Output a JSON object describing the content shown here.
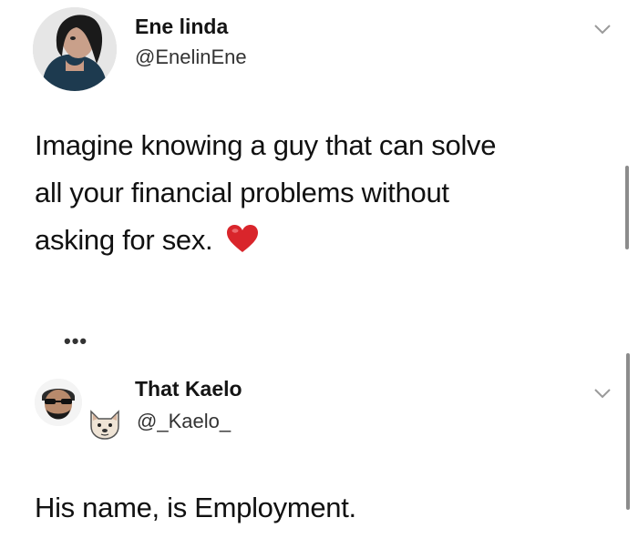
{
  "tweets": [
    {
      "display_name": "Ene linda",
      "handle": "@EnelinEne",
      "text_lines": [
        "Imagine knowing a guy that can solve",
        "all your financial problems without",
        "asking for sex."
      ],
      "emoji": "heart-emoji"
    },
    {
      "display_name": "That Kaelo",
      "handle": "@_Kaelo_",
      "text_lines": [
        "His name, is Employment."
      ]
    }
  ],
  "thread_more_icon": "more-dots-icon",
  "colors": {
    "background": "#ffffff",
    "text": "#111111",
    "heart": "#d9252b",
    "chevron": "#9a9a9a"
  }
}
